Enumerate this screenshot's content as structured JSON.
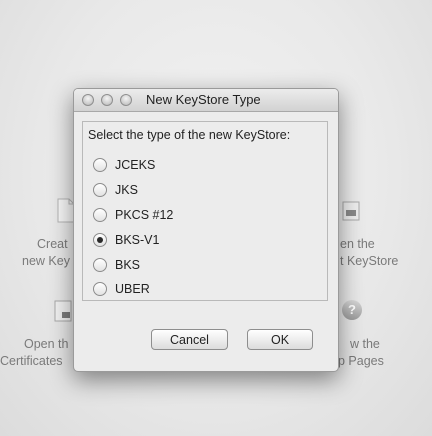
{
  "background": {
    "create_text": [
      "Creat",
      "new Key"
    ],
    "open_text_right": [
      "en the",
      "t KeyStore"
    ],
    "open_certs_text": [
      "Open th",
      "Certificates"
    ],
    "help_text": [
      "w the",
      "p Pages"
    ],
    "help_icon_glyph": "?"
  },
  "dialog": {
    "title": "New KeyStore Type",
    "prompt": "Select the type of the new KeyStore:",
    "options": [
      {
        "label": "JCEKS",
        "selected": false
      },
      {
        "label": "JKS",
        "selected": false
      },
      {
        "label": "PKCS #12",
        "selected": false
      },
      {
        "label": "BKS-V1",
        "selected": true
      },
      {
        "label": "BKS",
        "selected": false
      },
      {
        "label": "UBER",
        "selected": false
      }
    ],
    "cancel_label": "Cancel",
    "ok_label": "OK"
  }
}
